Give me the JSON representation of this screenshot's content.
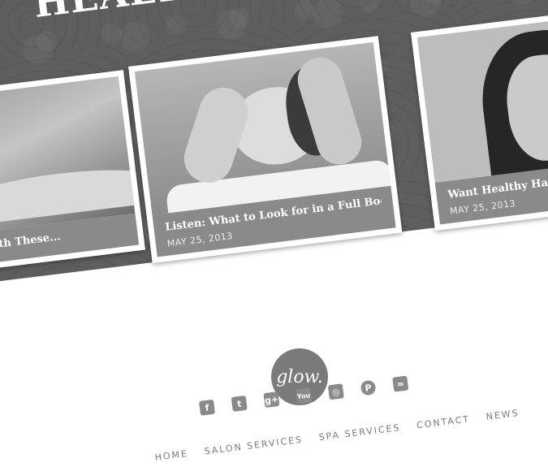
{
  "section": {
    "heading": "HEALTH & BEAUTY"
  },
  "cards": [
    {
      "title": "Get Ready with These...",
      "date": ""
    },
    {
      "title": "Listen: What to Look for in a Full Body Ma...",
      "date": "MAY 25, 2013"
    },
    {
      "title": "Want Healthy Hair? T...",
      "date": "MAY 25, 2013"
    }
  ],
  "footer": {
    "logo_text": "glow.",
    "social": [
      {
        "icon": "facebook-icon",
        "glyph": "f"
      },
      {
        "icon": "twitter-icon",
        "glyph": "t"
      },
      {
        "icon": "google-plus-icon",
        "glyph": "g+"
      },
      {
        "icon": "youtube-icon",
        "glyph": "You"
      },
      {
        "icon": "instagram-icon",
        "glyph": "◎"
      },
      {
        "icon": "pinterest-icon",
        "glyph": "P"
      },
      {
        "icon": "rss-icon",
        "glyph": "≈"
      }
    ],
    "nav": [
      "HOME",
      "SALON SERVICES",
      "SPA SERVICES",
      "CONTACT",
      "NEWS"
    ]
  }
}
